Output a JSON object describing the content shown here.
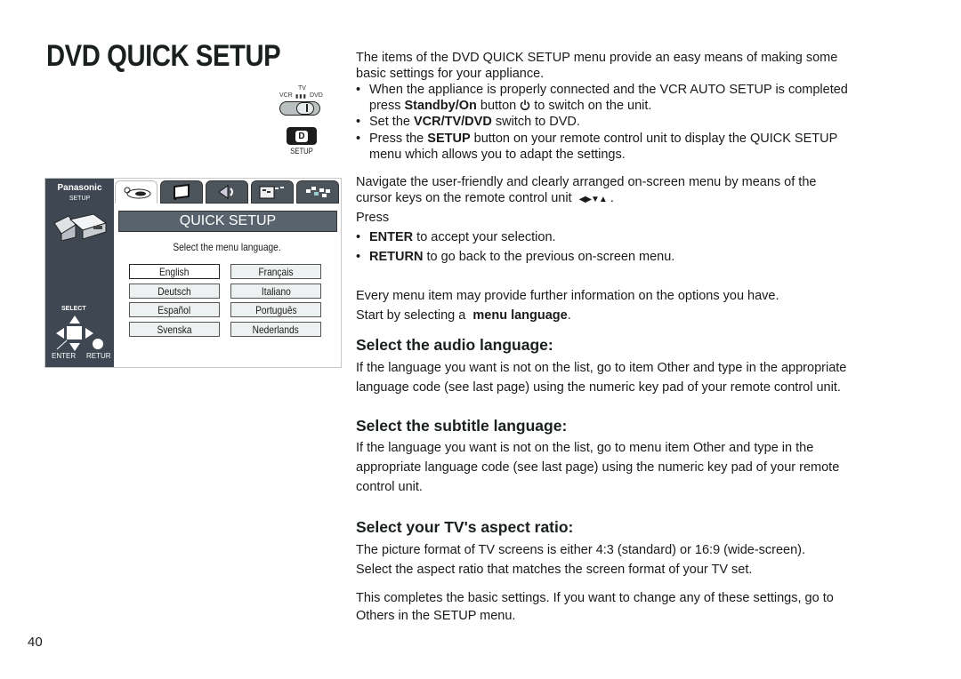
{
  "page": {
    "title": "DVD QUICK SETUP",
    "page_number": "40"
  },
  "remote": {
    "switch_labels": {
      "tv": "TV",
      "vcr": "VCR",
      "dvd": "DVD"
    },
    "switch_position": "DVD",
    "setup_key_glyph": "D",
    "setup_key_caption": "SETUP"
  },
  "osd": {
    "brand": "Panasonic",
    "brand_sub": "SETUP",
    "tabs": [
      {
        "icon": "disc-icon",
        "active": true
      },
      {
        "icon": "screen-icon",
        "active": false
      },
      {
        "icon": "speaker-icon",
        "active": false
      },
      {
        "icon": "display-menu-icon",
        "active": false
      },
      {
        "icon": "other-settings-icon",
        "active": false
      }
    ],
    "header": "QUICK SETUP",
    "prompt": "Select the menu language.",
    "languages": [
      "English",
      "Français",
      "Deutsch",
      "Italiano",
      "Español",
      "Português",
      "Svenska",
      "Nederlands"
    ],
    "selected_language": "English",
    "select_label": "SELECT",
    "enter_label": "ENTER",
    "return_label": "RETUR"
  },
  "intro": {
    "line1": "The items of the DVD QUICK SETUP menu provide an easy means of making some",
    "line2": "basic settings for your appliance.",
    "bullet1_line1": "When the appliance is properly connected and the VCR AUTO SETUP is completed",
    "bullet1_line2_a": "press ",
    "bullet1_line2_b": "Standby/On",
    "bullet1_line2_c": " button ",
    "bullet1_line2_d": " to switch on the unit.",
    "bullet2_a": "Set the ",
    "bullet2_b": "VCR/TV/DVD",
    "bullet2_c": " switch to DVD.",
    "bullet3_line1_a": "Press the ",
    "bullet3_line1_b": "SETUP",
    "bullet3_line1_c": " button on your remote control unit to display the QUICK SETUP",
    "bullet3_line2": "menu which allows you to adapt the settings."
  },
  "navigate": {
    "line1": "Navigate the user-friendly and clearly arranged on-screen menu by means of the",
    "line2": "cursor keys on the remote control unit",
    "cursor_glyphs": "◀▶▼▲",
    "line2_end": " .",
    "press": "Press",
    "enter_key": "ENTER",
    "enter_text": " to accept your selection.",
    "return_key": "RETURN",
    "return_text": " to go back to the previous on-screen menu.",
    "info_line": "Every menu item may provide further information on the options you have.",
    "start_a": "Start by selecting a  ",
    "start_b": "menu language",
    "start_c": "."
  },
  "sections": {
    "audio": {
      "heading": "Select the audio language:",
      "line1": "If the language you want is not on the list, go to item Other and type in the appropriate",
      "line2": "language code (see last page) using the numeric key pad of your remote control unit."
    },
    "subtitle": {
      "heading": "Select the subtitle language:",
      "line1": "If the language you want is not on the list, go to menu item Other and type in the",
      "line2": "appropriate language code (see last page) using the numeric key pad of your remote",
      "line3": "control unit."
    },
    "aspect": {
      "heading": "Select your TV's aspect ratio:",
      "line1": "The picture format of TV screens is either 4:3 (standard) or 16:9 (wide-screen).",
      "line2": "Select the aspect ratio that matches the screen format of your TV set."
    },
    "closing": {
      "line1": "This completes the basic settings. If you want to change any of these settings, go to",
      "line2": "Others in the SETUP menu."
    }
  }
}
